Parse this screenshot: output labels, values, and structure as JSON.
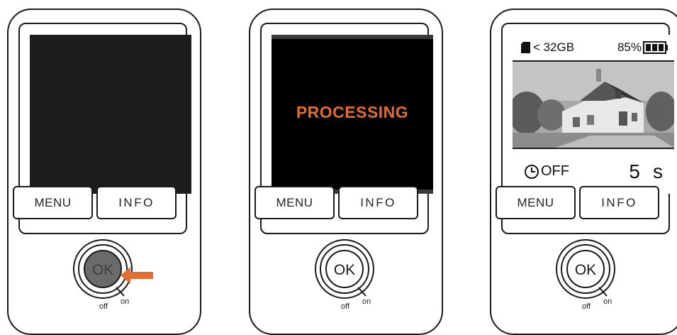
{
  "panels": [
    {
      "menu_label": "MENU",
      "info_label": "INFO",
      "ok_label": "OK",
      "switch_off": "off",
      "switch_on": "on"
    },
    {
      "menu_label": "MENU",
      "info_label": "INFO",
      "ok_label": "OK",
      "switch_off": "off",
      "switch_on": "on",
      "screen_text": "PROCESSING"
    },
    {
      "menu_label": "MENU",
      "info_label": "INFO",
      "ok_label": "OK",
      "switch_off": "off",
      "switch_on": "on",
      "storage": "< 32GB",
      "battery": "85%",
      "timer_state": "OFF",
      "timer_value": "5",
      "timer_unit": "s"
    }
  ],
  "colors": {
    "accent": "#e06e30",
    "screen_dark": "#1d1d1d",
    "ok_pressed": "#6b6b6b"
  },
  "icons": [
    "sd-card-icon",
    "battery-icon",
    "clock-icon",
    "arrow-left-icon"
  ]
}
